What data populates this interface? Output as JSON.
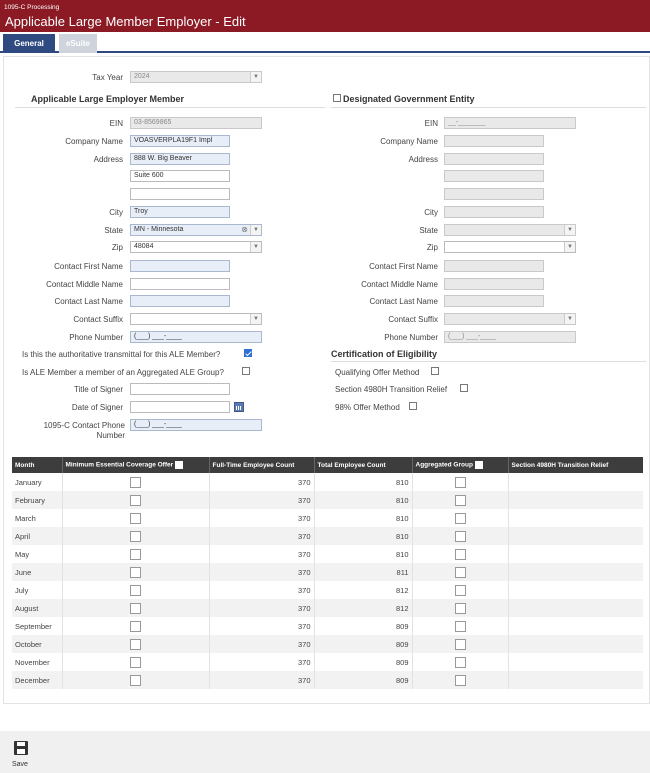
{
  "header": {
    "breadcrumb": "1095-C Processing",
    "title": "Applicable Large Member Employer - Edit"
  },
  "tabs": [
    {
      "label": "General",
      "active": true
    },
    {
      "label": "eSuite",
      "active": false
    }
  ],
  "tax_year": {
    "label": "Tax Year",
    "value": "2024"
  },
  "ale_member": {
    "title": "Applicable Large Employer Member",
    "ein": {
      "label": "EIN",
      "value": "03-8569865"
    },
    "company_name": {
      "label": "Company Name",
      "value": "VOASVERPLA19F1 Impl"
    },
    "address": {
      "label": "Address",
      "line1": "888 W. Big Beaver",
      "line2": "Suite 600",
      "line3": ""
    },
    "city": {
      "label": "City",
      "value": "Troy"
    },
    "state": {
      "label": "State",
      "value": "MN - Minnesota"
    },
    "zip": {
      "label": "Zip",
      "value": "48084"
    },
    "contact_first": {
      "label": "Contact First Name",
      "value": ""
    },
    "contact_middle": {
      "label": "Contact Middle Name",
      "value": ""
    },
    "contact_last": {
      "label": "Contact Last Name",
      "value": ""
    },
    "contact_suffix": {
      "label": "Contact Suffix",
      "value": ""
    },
    "phone": {
      "label": "Phone Number",
      "placeholder": "(___) ___-____"
    }
  },
  "questions": {
    "authoritative": {
      "label": "Is this the authoritative transmittal for this ALE Member?",
      "checked": true
    },
    "aggregated": {
      "label": "Is ALE Member a member of an Aggregated ALE Group?",
      "checked": false
    },
    "title_of_signer": {
      "label": "Title of Signer",
      "value": ""
    },
    "date_of_signer": {
      "label": "Date of Signer",
      "value": ""
    },
    "contact_phone": {
      "label": "1095-C Contact Phone Number",
      "placeholder": "(___) ___-____"
    }
  },
  "dge": {
    "title": "Designated Government Entity",
    "ein": {
      "label": "EIN",
      "placeholder": "__-_______"
    },
    "company_name": {
      "label": "Company Name"
    },
    "address": {
      "label": "Address"
    },
    "city": {
      "label": "City"
    },
    "state": {
      "label": "State"
    },
    "zip": {
      "label": "Zip"
    },
    "contact_first": {
      "label": "Contact First Name"
    },
    "contact_middle": {
      "label": "Contact Middle Name"
    },
    "contact_last": {
      "label": "Contact Last Name"
    },
    "contact_suffix": {
      "label": "Contact Suffix"
    },
    "phone": {
      "label": "Phone Number",
      "placeholder": "(___) ___-____"
    }
  },
  "certification": {
    "title": "Certification of Eligibility",
    "qualifying": {
      "label": "Qualifying Offer Method",
      "checked": false
    },
    "section_4980h": {
      "label": "Section 4980H Transition Relief",
      "checked": false
    },
    "offer_98": {
      "label": "98% Offer Method",
      "checked": false
    }
  },
  "table": {
    "headers": {
      "month": "Month",
      "mec": "Minimum Essential Coverage Offer",
      "fte": "Full-Time Employee Count",
      "total": "Total Employee Count",
      "agg": "Aggregated Group",
      "relief": "Section 4980H Transition Relief"
    },
    "rows": [
      {
        "month": "January",
        "fte": "370",
        "total": "810"
      },
      {
        "month": "February",
        "fte": "370",
        "total": "810"
      },
      {
        "month": "March",
        "fte": "370",
        "total": "810"
      },
      {
        "month": "April",
        "fte": "370",
        "total": "810"
      },
      {
        "month": "May",
        "fte": "370",
        "total": "810"
      },
      {
        "month": "June",
        "fte": "370",
        "total": "811"
      },
      {
        "month": "July",
        "fte": "370",
        "total": "812"
      },
      {
        "month": "August",
        "fte": "370",
        "total": "812"
      },
      {
        "month": "September",
        "fte": "370",
        "total": "809"
      },
      {
        "month": "October",
        "fte": "370",
        "total": "809"
      },
      {
        "month": "November",
        "fte": "370",
        "total": "809"
      },
      {
        "month": "December",
        "fte": "370",
        "total": "809"
      }
    ]
  },
  "footer": {
    "save_label": "Save"
  },
  "icons": {
    "save": "save-icon",
    "calendar": "calendar-icon",
    "dropdown": "chevron-down-icon",
    "clear": "clear-icon"
  },
  "colors": {
    "header_bg": "#8b1a24",
    "tab_active": "#2e4a80",
    "table_header": "#3d3d3d"
  }
}
